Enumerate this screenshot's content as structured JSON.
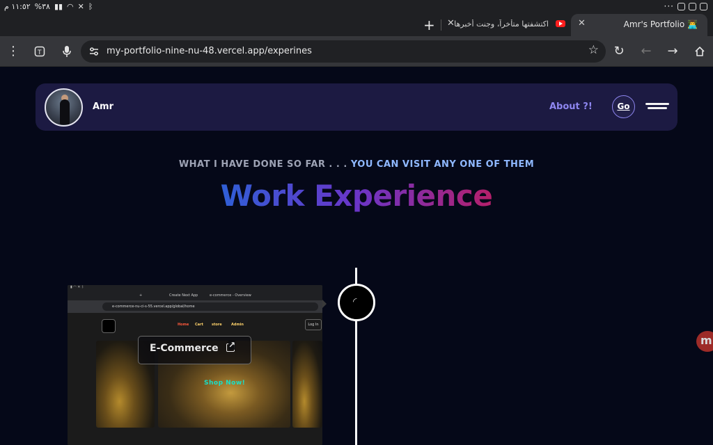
{
  "status_bar": {
    "time": "١١:٥٢ م",
    "battery": "%٣٨"
  },
  "tabs": {
    "active_title": "Amr's Portfolio 👨‍💻",
    "inactive_title": "اكتشفتها متأخراً، وجنت أخبرها لك",
    "new_tab": "+"
  },
  "toolbar": {
    "url": "my-portfolio-nine-nu-48.vercel.app/experines"
  },
  "navbar": {
    "name": "Amr",
    "about_label": "About ?!",
    "go_label": "Go"
  },
  "hero": {
    "subtitle_muted": "WHAT I HAVE DONE SO FAR . . . ",
    "subtitle_accent": "YOU CAN VISIT ANY ONE OF THEM",
    "title": "Work Experience"
  },
  "project": {
    "label": "E-Commerce",
    "shop_now": "Shop Now!",
    "mini_url": "e-commerce-nu-ci-s-55.vercel.app/global/home",
    "mini_tab_1": "Create Next App",
    "mini_tab_2": "e-commerce - Overview",
    "mini_nav": [
      "Home",
      "Cart",
      "store",
      "Admin"
    ],
    "mini_login": "Log In"
  },
  "side_badge": "m"
}
